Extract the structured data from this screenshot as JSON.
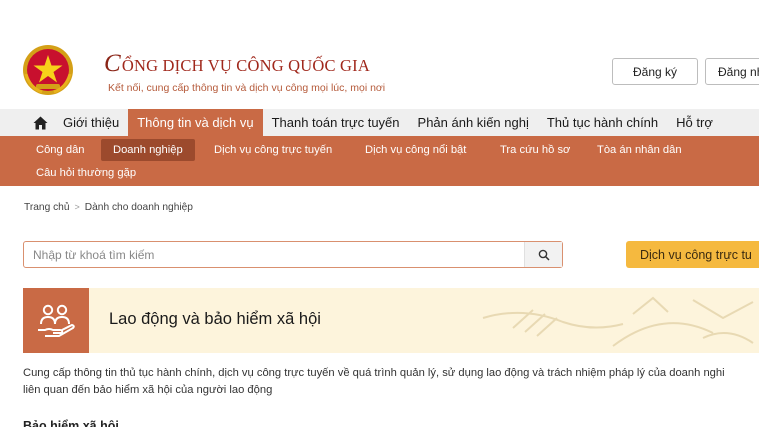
{
  "header": {
    "title_initial": "C",
    "title_rest": "ỔNG DỊCH VỤ CÔNG QUỐC GIA",
    "subtitle": "Kết nối, cung cấp thông tin và dịch vụ công mọi lúc, mọi nơi",
    "register_label": "Đăng ký",
    "login_label": "Đăng nh"
  },
  "main_nav": {
    "items": [
      {
        "label": "Giới thiệu"
      },
      {
        "label": "Thông tin và dịch vụ",
        "active": true
      },
      {
        "label": "Thanh toán trực tuyến"
      },
      {
        "label": "Phản ánh kiến nghị"
      },
      {
        "label": "Thủ tục hành chính"
      },
      {
        "label": "Hỗ trợ"
      }
    ]
  },
  "sub_nav": {
    "items": [
      {
        "label": "Công dân"
      },
      {
        "label": "Doanh nghiệp",
        "active": true
      },
      {
        "label": "Dịch vụ công trực tuyến"
      },
      {
        "label": "Dịch vụ công nổi bật"
      },
      {
        "label": "Tra cứu hồ sơ"
      },
      {
        "label": "Tòa án nhân dân"
      },
      {
        "label": "Câu hỏi thường gặp"
      }
    ]
  },
  "breadcrumb": {
    "home": "Trang chủ",
    "separator": ">",
    "current": "Dành cho doanh nghiệp"
  },
  "search": {
    "placeholder": "Nhập từ khoá tìm kiếm",
    "value": ""
  },
  "service_button_label": "Dịch vụ công trực tu",
  "banner": {
    "title": "Lao động và bảo hiểm xã hội"
  },
  "description": {
    "line1": "Cung cấp thông tin thủ tục hành chính, dịch vụ công trực tuyến về quá trình quản lý, sử dụng lao động và trách nhiệm pháp lý của doanh nghi",
    "line2": "liên quan đến bảo hiểm xã hội của người lao động"
  },
  "peek_heading": "Bảo hiểm xã hội",
  "colors": {
    "primary": "#c96a45",
    "active_sub": "#9c4a2d",
    "brand_red": "#a0281c",
    "accent_yellow": "#f5b93f",
    "banner_bg": "#fdf4dc",
    "nav_bg": "#efefef"
  }
}
